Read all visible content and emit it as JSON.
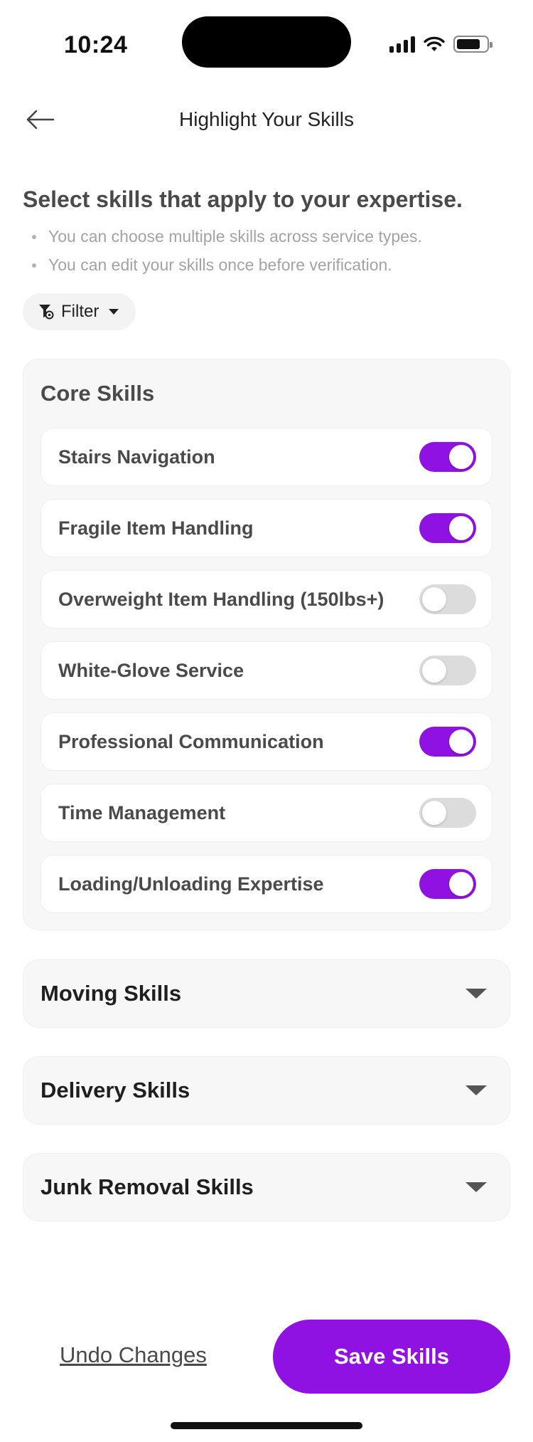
{
  "status_bar": {
    "time": "10:24"
  },
  "header": {
    "title": "Highlight Your Skills"
  },
  "intro": {
    "title": "Select skills that apply to your expertise.",
    "bullets": [
      "You can choose multiple skills across service types.",
      "You can edit your skills once before verification."
    ]
  },
  "filter": {
    "label": "Filter"
  },
  "core_skills": {
    "title": "Core Skills",
    "items": [
      {
        "label": "Stairs Navigation",
        "enabled": true
      },
      {
        "label": "Fragile Item Handling",
        "enabled": true
      },
      {
        "label": "Overweight Item Handling (150lbs+)",
        "enabled": false
      },
      {
        "label": "White-Glove Service",
        "enabled": false
      },
      {
        "label": "Professional Communication",
        "enabled": true
      },
      {
        "label": "Time Management",
        "enabled": false
      },
      {
        "label": "Loading/Unloading Expertise",
        "enabled": true
      }
    ]
  },
  "sections": [
    {
      "title": "Moving Skills"
    },
    {
      "title": "Delivery Skills"
    },
    {
      "title": "Junk Removal Skills"
    }
  ],
  "actions": {
    "undo_label": "Undo Changes",
    "save_label": "Save Skills"
  },
  "colors": {
    "accent": "#8f12e2",
    "toggle_off": "#dcdcdc"
  }
}
